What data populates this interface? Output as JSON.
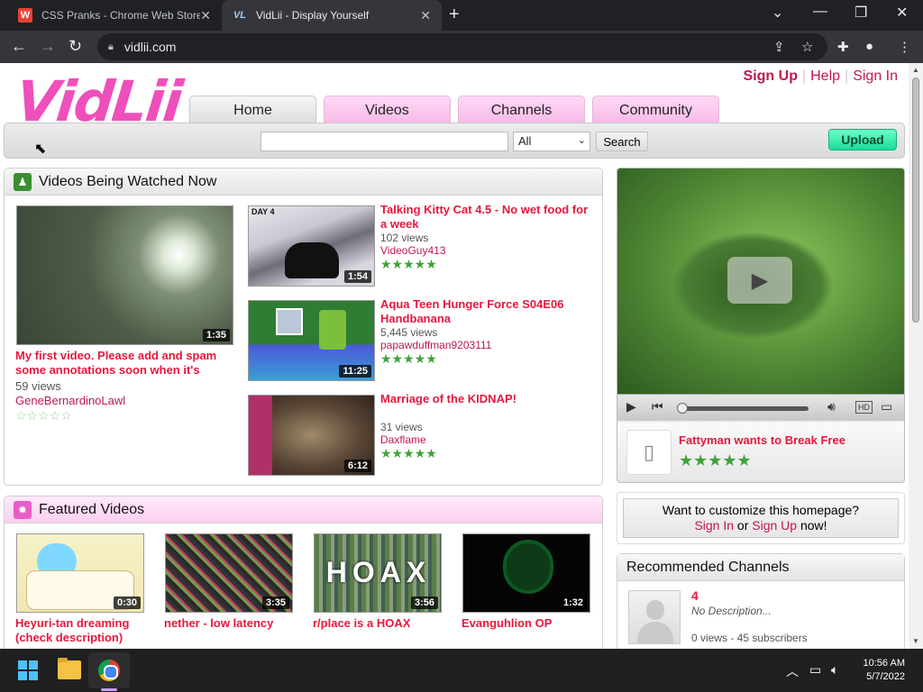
{
  "browser": {
    "tabs": [
      {
        "title": "CSS Pranks - Chrome Web Store",
        "favicon": "W"
      },
      {
        "title": "VidLii - Display Yourself",
        "favicon": "VL"
      }
    ],
    "url": "vidlii.com",
    "new_tab": "+",
    "window_controls": {
      "minimize": "—",
      "restore": "❐",
      "close": "✕",
      "tab_search": "⌄"
    }
  },
  "site": {
    "logo": "VidLii",
    "top_links": {
      "signup": "Sign Up",
      "help": "Help",
      "signin": "Sign In"
    },
    "nav_tabs": [
      "Home",
      "Videos",
      "Channels",
      "Community"
    ],
    "search": {
      "placeholder": "",
      "category": "All",
      "button": "Search"
    },
    "upload": "Upload",
    "colors": {
      "accent": "#e8173c",
      "pink_tab": "#f6b9e6",
      "upload": "#1bdc9a",
      "stars": "#3ea33a"
    }
  },
  "watched": {
    "heading": "Videos Being Watched Now",
    "main": {
      "title": "My first video. Please add and spam some annotations soon when it's",
      "views": "59 views",
      "user": "GeneBernardinoLawl",
      "duration": "1:35",
      "stars": "☆☆☆☆☆"
    },
    "items": [
      {
        "title": "Talking Kitty Cat 4.5 - No wet food for a week",
        "views": "102 views",
        "user": "VideoGuy413",
        "duration": "1:54",
        "stars": "★★★★★",
        "thumb_label": "DAY 4"
      },
      {
        "title": "Aqua Teen Hunger Force S04E06 Handbanana",
        "views": "5,445 views",
        "user": "papawduffman9203111",
        "duration": "11:25",
        "stars": "★★★★★"
      },
      {
        "title": "Marriage of the KIDNAP!",
        "views": "31 views",
        "user": "Daxflame",
        "duration": "6:12",
        "stars": "★★★★★"
      }
    ]
  },
  "featured": {
    "heading": "Featured Videos",
    "items": [
      {
        "title": "Heyuri-tan dreaming (check description)",
        "duration": "0:30"
      },
      {
        "title": "nether - low latency",
        "duration": "3:35"
      },
      {
        "title": "r/place is a HOAX",
        "duration": "3:56",
        "thumb_text": "HOAX"
      },
      {
        "title": "Evanguhlion OP",
        "duration": "1:32"
      }
    ]
  },
  "player": {
    "title": "Fattyman wants to Break Free",
    "stars": "★★★★★",
    "hd": "HD"
  },
  "customize": {
    "question": "Want to customize this homepage?",
    "signin": "Sign In",
    "or": " or ",
    "signup": "Sign Up",
    "suffix": " now!"
  },
  "recommended": {
    "heading": "Recommended Channels",
    "channel": {
      "name": "4",
      "description": "No Description...",
      "stats": "0 views - 45 subscribers"
    }
  },
  "taskbar": {
    "time": "10:56 AM",
    "date": "5/7/2022"
  }
}
